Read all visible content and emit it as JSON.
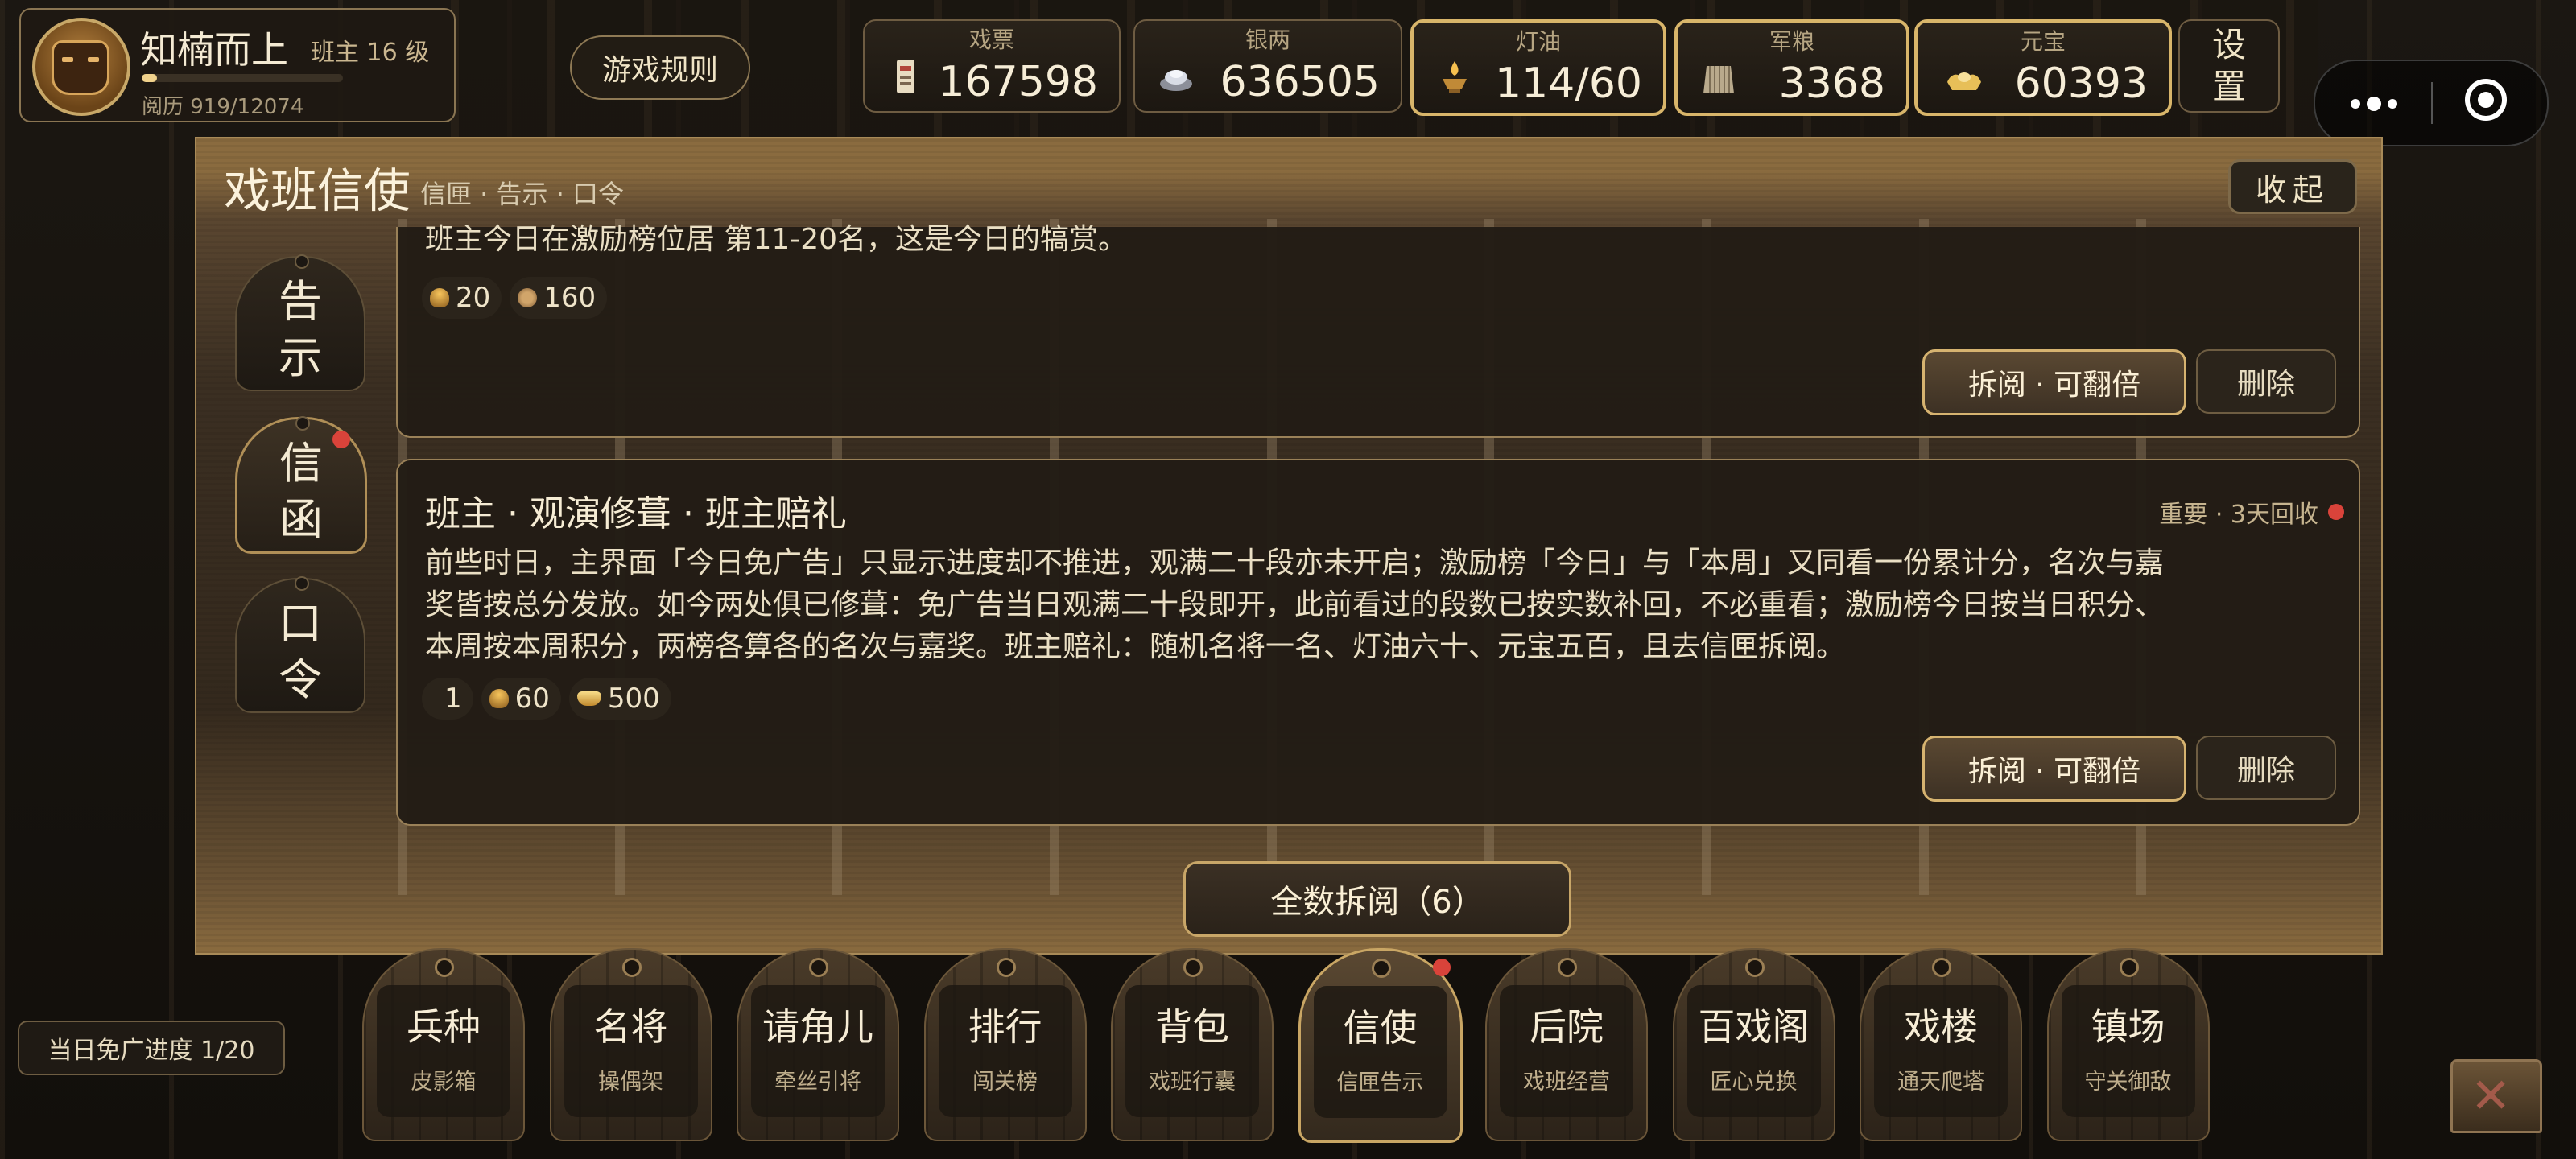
{
  "player": {
    "name": "知楠而上",
    "rank": "班主 16 级",
    "experience": "阅历 919/12074",
    "experience_fraction": 0.076
  },
  "top_buttons": {
    "rules": "游戏规则",
    "settings": [
      "设",
      "置"
    ]
  },
  "resources": [
    {
      "label": "戏票",
      "value": "167598",
      "icon": "ticket-icon"
    },
    {
      "label": "银两",
      "value": "636505",
      "icon": "silver-icon"
    },
    {
      "label": "灯油",
      "value": "114/60",
      "icon": "oil-lamp-icon"
    },
    {
      "label": "军粮",
      "value": "3368",
      "icon": "grain-sack-icon"
    },
    {
      "label": "元宝",
      "value": "60393",
      "icon": "gold-ingot-icon"
    }
  ],
  "panel": {
    "title": "戏班信使",
    "subtitle": "信匣 · 告示 · 口令",
    "collapse": "收起",
    "side_tabs": [
      {
        "label_1": "告",
        "label_2": "示",
        "active": false
      },
      {
        "label_1": "信",
        "label_2": "函",
        "active": true
      },
      {
        "label_1": "口",
        "label_2": "令",
        "active": false
      }
    ],
    "mail": [
      {
        "text": "班主今日在激励榜位居 第11-20名，这是今日的犒赏。",
        "rewards": [
          {
            "icon": "oil",
            "amount": "20"
          },
          {
            "icon": "biscuit",
            "amount": "160"
          }
        ],
        "open": "拆阅 · 可翻倍",
        "delete": "删除"
      },
      {
        "title": "班主 · 观演修葺 · 班主赔礼",
        "meta": "重要 · 3天回收",
        "lines": [
          "前些时日，主界面「今日免广告」只显示进度却不推进，观满二十段亦未开启；激励榜「今日」与「本周」又同看一份累计分，名次与嘉",
          "奖皆按总分发放。如今两处俱已修葺：免广告当日观满二十段即开，此前看过的段数已按实数补回，不必重看；激励榜今日按当日积分、",
          "本周按本周积分，两榜各算各的名次与嘉奖。班主赔礼：随机名将一名、灯油六十、元宝五百，且去信匣拆阅。"
        ],
        "rewards": [
          {
            "icon": "blank",
            "amount": "1"
          },
          {
            "icon": "oil",
            "amount": "60"
          },
          {
            "icon": "ingot",
            "amount": "500"
          }
        ],
        "open": "拆阅 · 可翻倍",
        "delete": "删除"
      }
    ],
    "open_all": "全数拆阅（6）"
  },
  "ad_progress": "当日免广进度 1/20",
  "nav": [
    {
      "label": "兵种",
      "sub": "皮影箱"
    },
    {
      "label": "名将",
      "sub": "操偶架"
    },
    {
      "label": "请角儿",
      "sub": "牵丝引将"
    },
    {
      "label": "排行",
      "sub": "闯关榜"
    },
    {
      "label": "背包",
      "sub": "戏班行囊"
    },
    {
      "label": "信使",
      "sub": "信匣告示",
      "active": true
    },
    {
      "label": "后院",
      "sub": "戏班经营"
    },
    {
      "label": "百戏阁",
      "sub": "匠心兑换"
    },
    {
      "label": "戏楼",
      "sub": "通天爬塔"
    },
    {
      "label": "镇场",
      "sub": "守关御敌"
    }
  ],
  "colors": {
    "accent_gold": "#d6b370",
    "notification_red": "#d9433a",
    "panel_bg": "#34291d"
  }
}
